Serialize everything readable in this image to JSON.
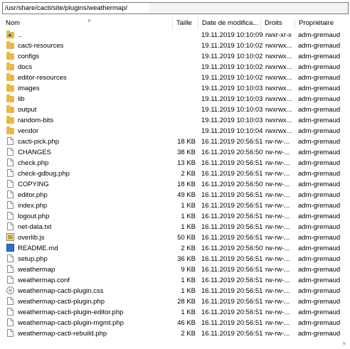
{
  "path": "/usr/share/cacti/site/plugins/weathermap/",
  "columns": {
    "name": "Nom",
    "size": "Taille",
    "date": "Date de modifica...",
    "perms": "Droits",
    "owner": "Propriétaire"
  },
  "rows": [
    {
      "name": "..",
      "icon": "folder-up-icon",
      "size": "",
      "date": "19.11.2019 10:10:09",
      "perms": "rwxr-xr-x",
      "owner": "adm-gremaud"
    },
    {
      "name": "cacti-resources",
      "icon": "folder-icon",
      "size": "",
      "date": "19.11.2019 10:10:02",
      "perms": "rwxrwx...",
      "owner": "adm-gremaud"
    },
    {
      "name": "configs",
      "icon": "folder-icon",
      "size": "",
      "date": "19.11.2019 10:10:02",
      "perms": "rwxrwx...",
      "owner": "adm-gremaud"
    },
    {
      "name": "docs",
      "icon": "folder-icon",
      "size": "",
      "date": "19.11.2019 10:10:02",
      "perms": "rwxrwx...",
      "owner": "adm-gremaud"
    },
    {
      "name": "editor-resources",
      "icon": "folder-icon",
      "size": "",
      "date": "19.11.2019 10:10:02",
      "perms": "rwxrwx...",
      "owner": "adm-gremaud"
    },
    {
      "name": "images",
      "icon": "folder-icon",
      "size": "",
      "date": "19.11.2019 10:10:03",
      "perms": "rwxrwx...",
      "owner": "adm-gremaud"
    },
    {
      "name": "lib",
      "icon": "folder-icon",
      "size": "",
      "date": "19.11.2019 10:10:03",
      "perms": "rwxrwx...",
      "owner": "adm-gremaud"
    },
    {
      "name": "output",
      "icon": "folder-icon",
      "size": "",
      "date": "19.11.2019 10:10:03",
      "perms": "rwxrwx...",
      "owner": "adm-gremaud"
    },
    {
      "name": "random-bits",
      "icon": "folder-icon",
      "size": "",
      "date": "19.11.2019 10:10:03",
      "perms": "rwxrwx...",
      "owner": "adm-gremaud"
    },
    {
      "name": "vendor",
      "icon": "folder-icon",
      "size": "",
      "date": "19.11.2019 10:10:04",
      "perms": "rwxrwx...",
      "owner": "adm-gremaud"
    },
    {
      "name": "cacti-pick.php",
      "icon": "file-icon",
      "size": "18 KB",
      "date": "16.11.2019 20:56:51",
      "perms": "rw-rw-...",
      "owner": "adm-gremaud"
    },
    {
      "name": "CHANGES",
      "icon": "file-icon",
      "size": "38 KB",
      "date": "16.11.2019 20:56:50",
      "perms": "rw-rw-...",
      "owner": "adm-gremaud"
    },
    {
      "name": "check.php",
      "icon": "file-icon",
      "size": "13 KB",
      "date": "16.11.2019 20:56:51",
      "perms": "rw-rw-...",
      "owner": "adm-gremaud"
    },
    {
      "name": "check-gdbug.php",
      "icon": "file-icon",
      "size": "2 KB",
      "date": "16.11.2019 20:56:51",
      "perms": "rw-rw-...",
      "owner": "adm-gremaud"
    },
    {
      "name": "COPYING",
      "icon": "file-icon",
      "size": "18 KB",
      "date": "16.11.2019 20:56:50",
      "perms": "rw-rw-...",
      "owner": "adm-gremaud"
    },
    {
      "name": "editor.php",
      "icon": "file-icon",
      "size": "49 KB",
      "date": "16.11.2019 20:56:51",
      "perms": "rw-rw-...",
      "owner": "adm-gremaud"
    },
    {
      "name": "index.php",
      "icon": "file-icon",
      "size": "1 KB",
      "date": "16.11.2019 20:56:51",
      "perms": "rw-rw-...",
      "owner": "adm-gremaud"
    },
    {
      "name": "logout.php",
      "icon": "file-icon",
      "size": "1 KB",
      "date": "16.11.2019 20:56:51",
      "perms": "rw-rw-...",
      "owner": "adm-gremaud"
    },
    {
      "name": "net-data.txt",
      "icon": "file-icon",
      "size": "1 KB",
      "date": "16.11.2019 20:56:51",
      "perms": "rw-rw-...",
      "owner": "adm-gremaud"
    },
    {
      "name": "overlib.js",
      "icon": "js-file-icon",
      "size": "50 KB",
      "date": "16.11.2019 20:56:51",
      "perms": "rw-rw-...",
      "owner": "adm-gremaud"
    },
    {
      "name": "README.md",
      "icon": "md-file-icon",
      "size": "2 KB",
      "date": "16.11.2019 20:56:50",
      "perms": "rw-rw-...",
      "owner": "adm-gremaud"
    },
    {
      "name": "setup.php",
      "icon": "file-icon",
      "size": "36 KB",
      "date": "16.11.2019 20:56:51",
      "perms": "rw-rw-...",
      "owner": "adm-gremaud"
    },
    {
      "name": "weathermap",
      "icon": "file-icon",
      "size": "9 KB",
      "date": "16.11.2019 20:56:51",
      "perms": "rw-rw-...",
      "owner": "adm-gremaud"
    },
    {
      "name": "weathermap.conf",
      "icon": "file-icon",
      "size": "1 KB",
      "date": "16.11.2019 20:56:51",
      "perms": "rw-rw-...",
      "owner": "adm-gremaud"
    },
    {
      "name": "weathermap-cacti-plugin.css",
      "icon": "css-file-icon",
      "size": "1 KB",
      "date": "16.11.2019 20:56:51",
      "perms": "rw-rw-...",
      "owner": "adm-gremaud"
    },
    {
      "name": "weathermap-cacti-plugin.php",
      "icon": "file-icon",
      "size": "28 KB",
      "date": "16.11.2019 20:56:51",
      "perms": "rw-rw-...",
      "owner": "adm-gremaud"
    },
    {
      "name": "weathermap-cacti-plugin-editor.php",
      "icon": "file-icon",
      "size": "1 KB",
      "date": "16.11.2019 20:56:51",
      "perms": "rw-rw-...",
      "owner": "adm-gremaud"
    },
    {
      "name": "weathermap-cacti-plugin-mgmt.php",
      "icon": "file-icon",
      "size": "46 KB",
      "date": "16.11.2019 20:56:51",
      "perms": "rw-rw-...",
      "owner": "adm-gremaud"
    },
    {
      "name": "weathermap-cacti-rebuild.php",
      "icon": "file-icon",
      "size": "2 KB",
      "date": "16.11.2019 20:56:51",
      "perms": "rw-rw-...",
      "owner": "adm-gremaud"
    }
  ]
}
